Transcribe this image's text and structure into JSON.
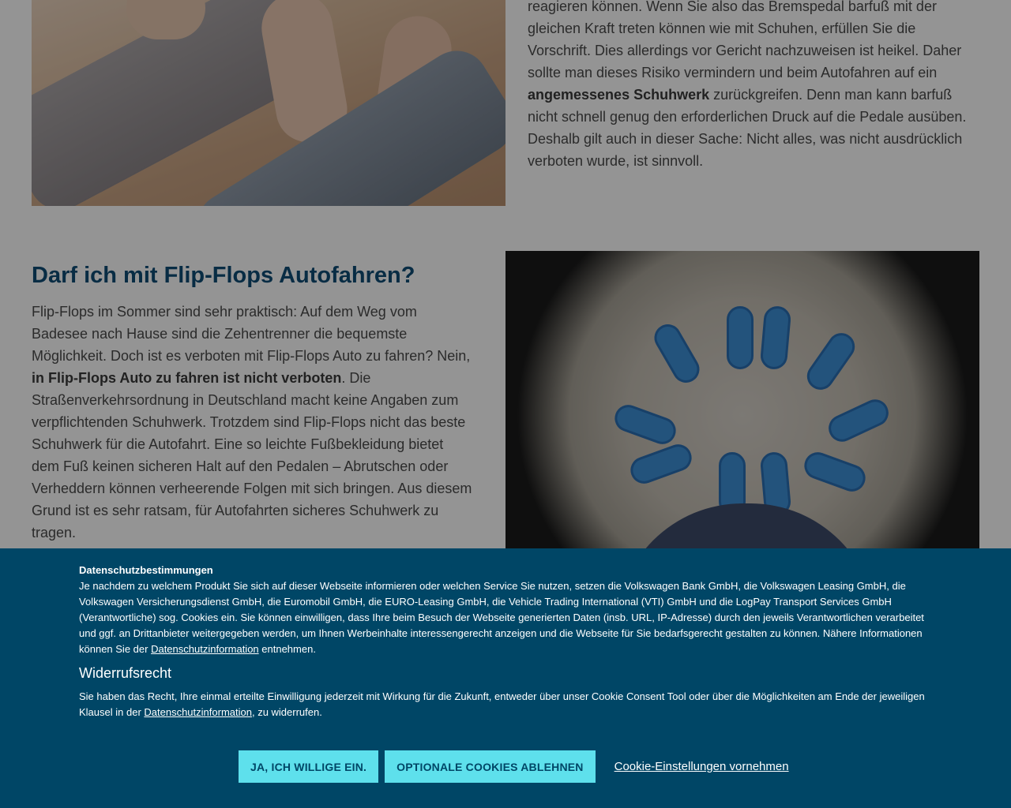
{
  "article": {
    "paragraph_top": {
      "t1": "reagieren können. Wenn Sie also das Bremspedal barfuß mit der gleichen Kraft treten können wie mit Schuhen, erfüllen Sie die Vorschrift. Dies allerdings vor Gericht nachzuweisen ist heikel. Daher sollte man dieses Risiko vermindern und beim Autofahren auf ein ",
      "b1": "angemessenes Schuhwerk",
      "t2": " zurückgreifen. Denn man kann barfuß nicht schnell genug den erforderlichen Druck auf die Pedale ausüben. Deshalb gilt auch in dieser Sache: Nicht alles, was nicht ausdrücklich verboten wurde, ist sinnvoll."
    },
    "section_title": "Darf ich mit Flip-Flops Autofahren?",
    "paragraph_flipflops": {
      "t1": "Flip-Flops im Sommer sind sehr praktisch: Auf dem Weg vom Badesee nach Hause sind die Zehentrenner die bequemste Möglichkeit. Doch ist es verboten mit Flip-Flops Auto zu fahren? Nein, ",
      "b1": "in Flip-Flops Auto zu fahren ist nicht verboten",
      "t2": ". Die Straßenverkehrsordnung in Deutschland macht keine Angaben zum verpflichtenden Schuhwerk. Trotzdem sind Flip-Flops nicht das beste Schuhwerk für die Autofahrt. Eine so leichte Fußbekleidung bietet dem Fuß keinen sicheren Halt auf den Pedalen – Abrutschen oder Verheddern können verheerende Folgen mit sich bringen. Aus diesem Grund ist es sehr ratsam, für Autofahrten sicheres Schuhwerk zu tragen."
    }
  },
  "cookie_banner": {
    "title": "Datenschutzbestimmungen",
    "text1": "Je nachdem zu welchem Produkt Sie sich auf dieser Webseite informieren oder welchen Service Sie nutzen, setzen die Volkswagen Bank GmbH, die Volkswagen Leasing GmbH, die Volkswagen Versicherungsdienst GmbH, die Euromobil GmbH, die EURO-Leasing GmbH, die Vehicle Trading International (VTI) GmbH und die LogPay Transport Services GmbH (Verantwortliche) sog. Cookies ein. Sie können einwilligen, dass Ihre beim Besuch der Webseite generierten Daten (insb. URL, IP-Adresse) durch den jeweils Verantwortlichen verarbeitet und ggf. an Drittanbieter weitergegeben werden, um Ihnen Werbeinhalte interessengerecht anzeigen und die Webseite für Sie bedarfsgerecht gestalten zu können. Nähere Informationen können Sie der ",
    "link1": "Datenschutzinformation",
    "text1_end": " entnehmen.",
    "subtitle": "Widerrufsrecht",
    "text2": "Sie haben das Recht, Ihre einmal erteilte Einwilligung jederzeit mit Wirkung für die Zukunft, entweder über unser Cookie Consent Tool oder über die Möglichkeiten am Ende der jeweiligen Klausel in der ",
    "link2": "Datenschutzinformation",
    "text2_end": ", zu widerrufen.",
    "btn_accept": "JA, ICH WILLIGE EIN.",
    "btn_reject": "OPTIONALE COOKIES ABLEHNEN",
    "link_settings": "Cookie-Einstellungen vornehmen"
  }
}
